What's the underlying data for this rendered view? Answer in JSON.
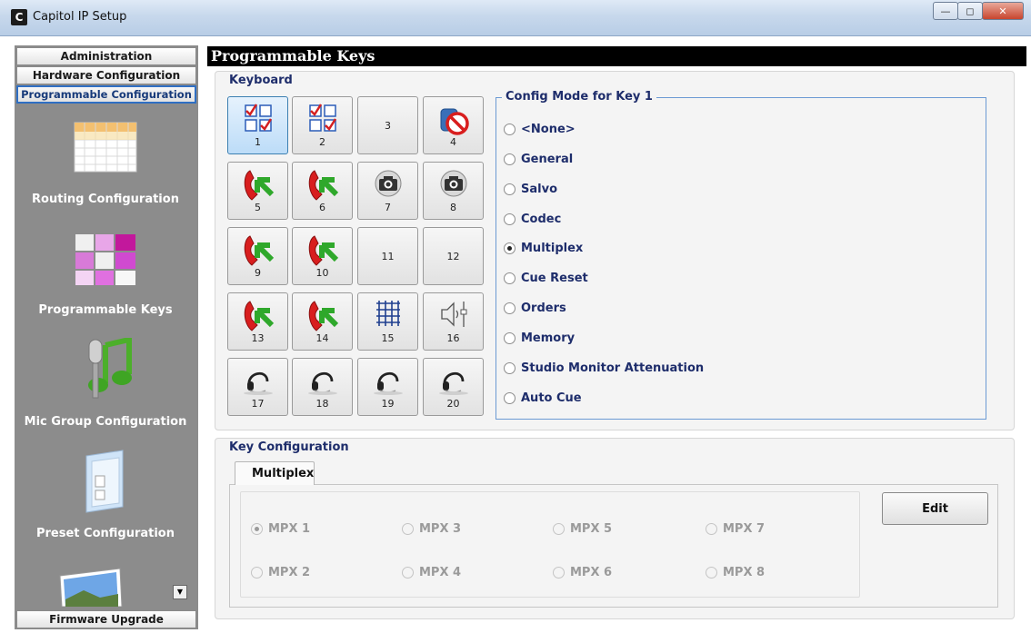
{
  "window": {
    "title": "Capitol IP Setup",
    "app_icon_letter": "C"
  },
  "sidebar": {
    "top_buttons": [
      "Administration",
      "Hardware Configuration",
      "Programmable Configuration"
    ],
    "items": [
      {
        "label": "Routing Configuration",
        "icon": "routing-grid-icon"
      },
      {
        "label": "Programmable Keys",
        "icon": "programmable-keys-icon"
      },
      {
        "label": "Mic Group Configuration",
        "icon": "microphone-music-icon"
      },
      {
        "label": "Preset Configuration",
        "icon": "folder-preset-icon"
      }
    ],
    "bottom_button": "Firmware Upgrade"
  },
  "content": {
    "header": "Programmable Keys",
    "keyboard_title": "Keyboard",
    "keys": [
      {
        "num": "1",
        "icon": "checkbox-grid-icon",
        "selected": true
      },
      {
        "num": "2",
        "icon": "checkbox-grid-icon"
      },
      {
        "num": "3",
        "icon": ""
      },
      {
        "num": "4",
        "icon": "no-phone-icon"
      },
      {
        "num": "5",
        "icon": "phone-arrow-icon"
      },
      {
        "num": "6",
        "icon": "phone-arrow-icon"
      },
      {
        "num": "7",
        "icon": "camera-icon"
      },
      {
        "num": "8",
        "icon": "camera-icon"
      },
      {
        "num": "9",
        "icon": "phone-arrow-icon"
      },
      {
        "num": "10",
        "icon": "phone-arrow-icon"
      },
      {
        "num": "11",
        "icon": ""
      },
      {
        "num": "12",
        "icon": ""
      },
      {
        "num": "13",
        "icon": "phone-arrow-icon"
      },
      {
        "num": "14",
        "icon": "phone-arrow-icon"
      },
      {
        "num": "15",
        "icon": "matrix-grid-icon"
      },
      {
        "num": "16",
        "icon": "speaker-fader-icon"
      },
      {
        "num": "17",
        "icon": "headset-icon"
      },
      {
        "num": "18",
        "icon": "headset-icon"
      },
      {
        "num": "19",
        "icon": "headset-icon"
      },
      {
        "num": "20",
        "icon": "headset-icon"
      }
    ],
    "config_mode": {
      "legend": "Config Mode for Key 1",
      "options": [
        "<None>",
        "General",
        "Salvo",
        "Codec",
        "Multiplex",
        "Cue Reset",
        "Orders",
        "Memory",
        "Studio Monitor Attenuation",
        "Auto Cue"
      ],
      "selected": "Multiplex"
    },
    "key_configuration": {
      "title": "Key Configuration",
      "tab": "Multiplex",
      "mpx_options": [
        "MPX 1",
        "MPX 3",
        "MPX 5",
        "MPX 7",
        "MPX 2",
        "MPX 4",
        "MPX 6",
        "MPX 8"
      ],
      "selected": "MPX 1",
      "edit_label": "Edit"
    }
  }
}
